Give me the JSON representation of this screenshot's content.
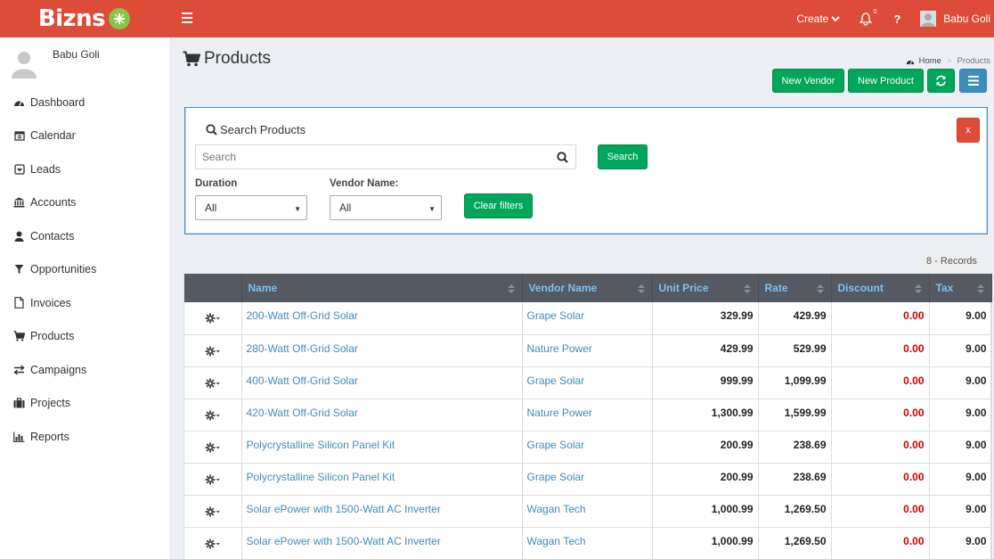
{
  "brand": {
    "name": "Bizns"
  },
  "topnav": {
    "create_label": "Create",
    "bell_count": "0",
    "help_label": "?",
    "user_name": "Babu Goli"
  },
  "sidebar": {
    "user_name": "Babu Goli",
    "items": [
      {
        "label": "Dashboard",
        "icon": "dashboard-icon"
      },
      {
        "label": "Calendar",
        "icon": "calendar-icon"
      },
      {
        "label": "Leads",
        "icon": "leads-icon"
      },
      {
        "label": "Accounts",
        "icon": "bank-icon"
      },
      {
        "label": "Contacts",
        "icon": "user-icon"
      },
      {
        "label": "Opportunities",
        "icon": "filter-icon"
      },
      {
        "label": "Invoices",
        "icon": "file-icon"
      },
      {
        "label": "Products",
        "icon": "cart-icon"
      },
      {
        "label": "Campaigns",
        "icon": "exchange-icon"
      },
      {
        "label": "Projects",
        "icon": "briefcase-icon"
      },
      {
        "label": "Reports",
        "icon": "bar-chart-icon"
      }
    ]
  },
  "page": {
    "title": "Products",
    "breadcrumb": {
      "home": "Home",
      "sep": ">",
      "current": "Products"
    },
    "buttons": {
      "new_vendor": "New Vendor",
      "new_product": "New Product"
    }
  },
  "search": {
    "title": "Search Products",
    "placeholder": "Search",
    "button": "Search",
    "close": "x",
    "duration_label": "Duration",
    "duration_value": "All",
    "vendor_label": "Vendor Name:",
    "vendor_value": "All",
    "clear_button": "Clear filters"
  },
  "records": "8 - Records",
  "colors": {
    "accent": "#dd4b39",
    "green": "#00a65a",
    "blue": "#3c8dbc",
    "header": "#555962",
    "discount": "#cc0000"
  },
  "table": {
    "columns": [
      "Name",
      "Vendor Name",
      "Unit Price",
      "Rate",
      "Discount",
      "Tax"
    ],
    "rows": [
      [
        "200-Watt Off-Grid Solar",
        "Grape Solar",
        "329.99",
        "429.99",
        "0.00",
        "9.00"
      ],
      [
        "280-Watt Off-Grid Solar",
        "Nature Power",
        "429.99",
        "529.99",
        "0.00",
        "9.00"
      ],
      [
        "400-Watt Off-Grid Solar",
        "Grape Solar",
        "999.99",
        "1,099.99",
        "0.00",
        "9.00"
      ],
      [
        "420-Watt Off-Grid Solar",
        "Nature Power",
        "1,300.99",
        "1,599.99",
        "0.00",
        "9.00"
      ],
      [
        "Polycrystalline Silicon Panel Kit",
        "Grape Solar",
        "200.99",
        "238.69",
        "0.00",
        "9.00"
      ],
      [
        "Polycrystalline Silicon Panel Kit",
        "Grape Solar",
        "200.99",
        "238.69",
        "0.00",
        "9.00"
      ],
      [
        "Solar ePower with 1500-Watt AC Inverter",
        "Wagan Tech",
        "1,000.99",
        "1,269.50",
        "0.00",
        "9.00"
      ],
      [
        "Solar ePower with 1500-Watt AC Inverter",
        "Wagan Tech",
        "1,000.99",
        "1,269.50",
        "0.00",
        "9.00"
      ]
    ]
  }
}
